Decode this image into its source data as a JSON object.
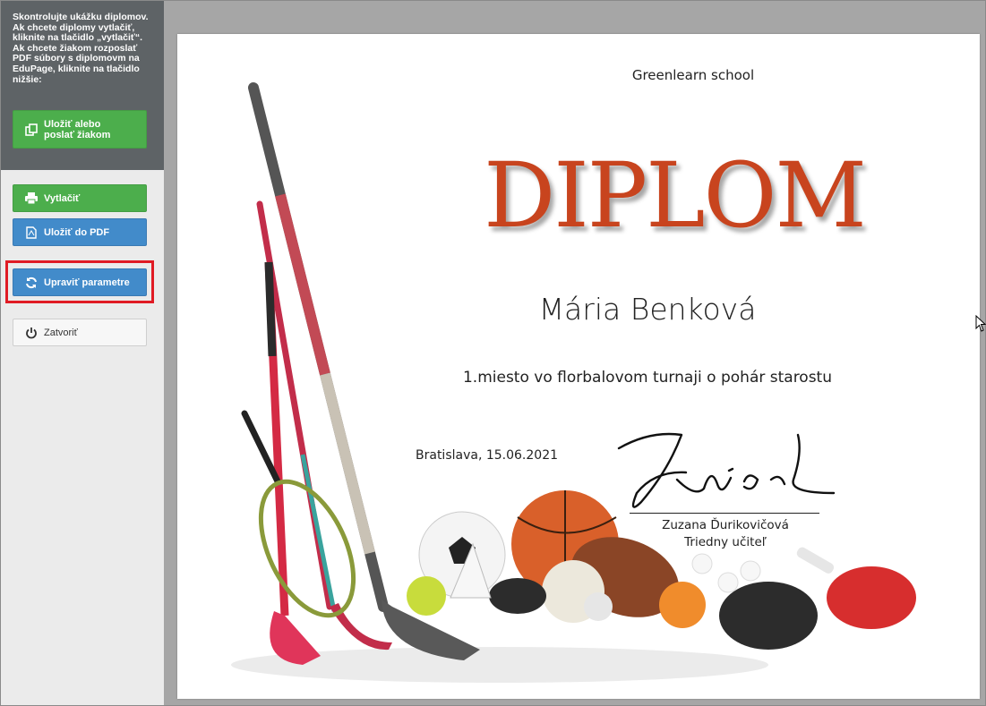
{
  "sidebar": {
    "instructions": "Skontrolujte ukážku diplomov. Ak chcete diplomy vytlačiť, kliknite na tlačidlo „vytlačiť“. Ak chcete žiakom rozposlať PDF súbory s diplomovm na EduPage, kliknite na tlačidlo nižšie:",
    "save_send_label": "Uložiť alebo poslať žiakom",
    "print_label": "Vytlačiť",
    "pdf_label": "Uložiť do PDF",
    "params_label": "Upraviť parametre",
    "close_label": "Zatvoriť"
  },
  "diploma": {
    "school": "Greenlearn school",
    "title": "DIPLOM",
    "recipient": "Mária Benková",
    "achievement": "1.miesto vo florbalovom turnaji o pohár starostu",
    "place_date": "Bratislava, 15.06.2021",
    "signer_name": "Zuzana Ďurikovičová",
    "signer_role": "Triedny učiteľ"
  },
  "colors": {
    "title": "#c8441e",
    "green_button": "#4cae4c",
    "blue_button": "#428bca",
    "highlight": "#e01b24",
    "info_panel": "#5e6366"
  }
}
